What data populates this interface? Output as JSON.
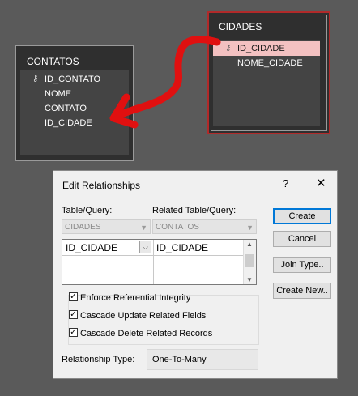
{
  "tables": {
    "contatos": {
      "title": "CONTATOS",
      "fields": [
        "ID_CONTATO",
        "NOME",
        "CONTATO",
        "ID_CIDADE"
      ]
    },
    "cidades": {
      "title": "CIDADES",
      "fields": [
        "ID_CIDADE",
        "NOME_CIDADE"
      ]
    }
  },
  "dialog": {
    "title": "Edit Relationships",
    "help": "?",
    "close": "✕",
    "table_query_label": "Table/Query:",
    "related_label": "Related Table/Query:",
    "table_query_value": "CIDADES",
    "related_value": "CONTATOS",
    "grid": {
      "left_field": "ID_CIDADE",
      "right_field": "ID_CIDADE"
    },
    "buttons": {
      "create": "Create",
      "cancel": "Cancel",
      "join_type": "Join Type..",
      "create_new": "Create New.."
    },
    "options": {
      "enforce": "Enforce Referential Integrity",
      "cascade_update": "Cascade Update Related Fields",
      "cascade_delete": "Cascade Delete Related Records"
    },
    "relationship_type_label": "Relationship Type:",
    "relationship_type_value": "One-To-Many"
  },
  "colors": {
    "highlight_border": "#b12a2a",
    "arrow": "#e01010",
    "selected_field": "#f3c1c1"
  },
  "icons": {
    "key": "key-icon",
    "dropdown": "chevron-down-icon",
    "check": "checkmark-icon"
  }
}
